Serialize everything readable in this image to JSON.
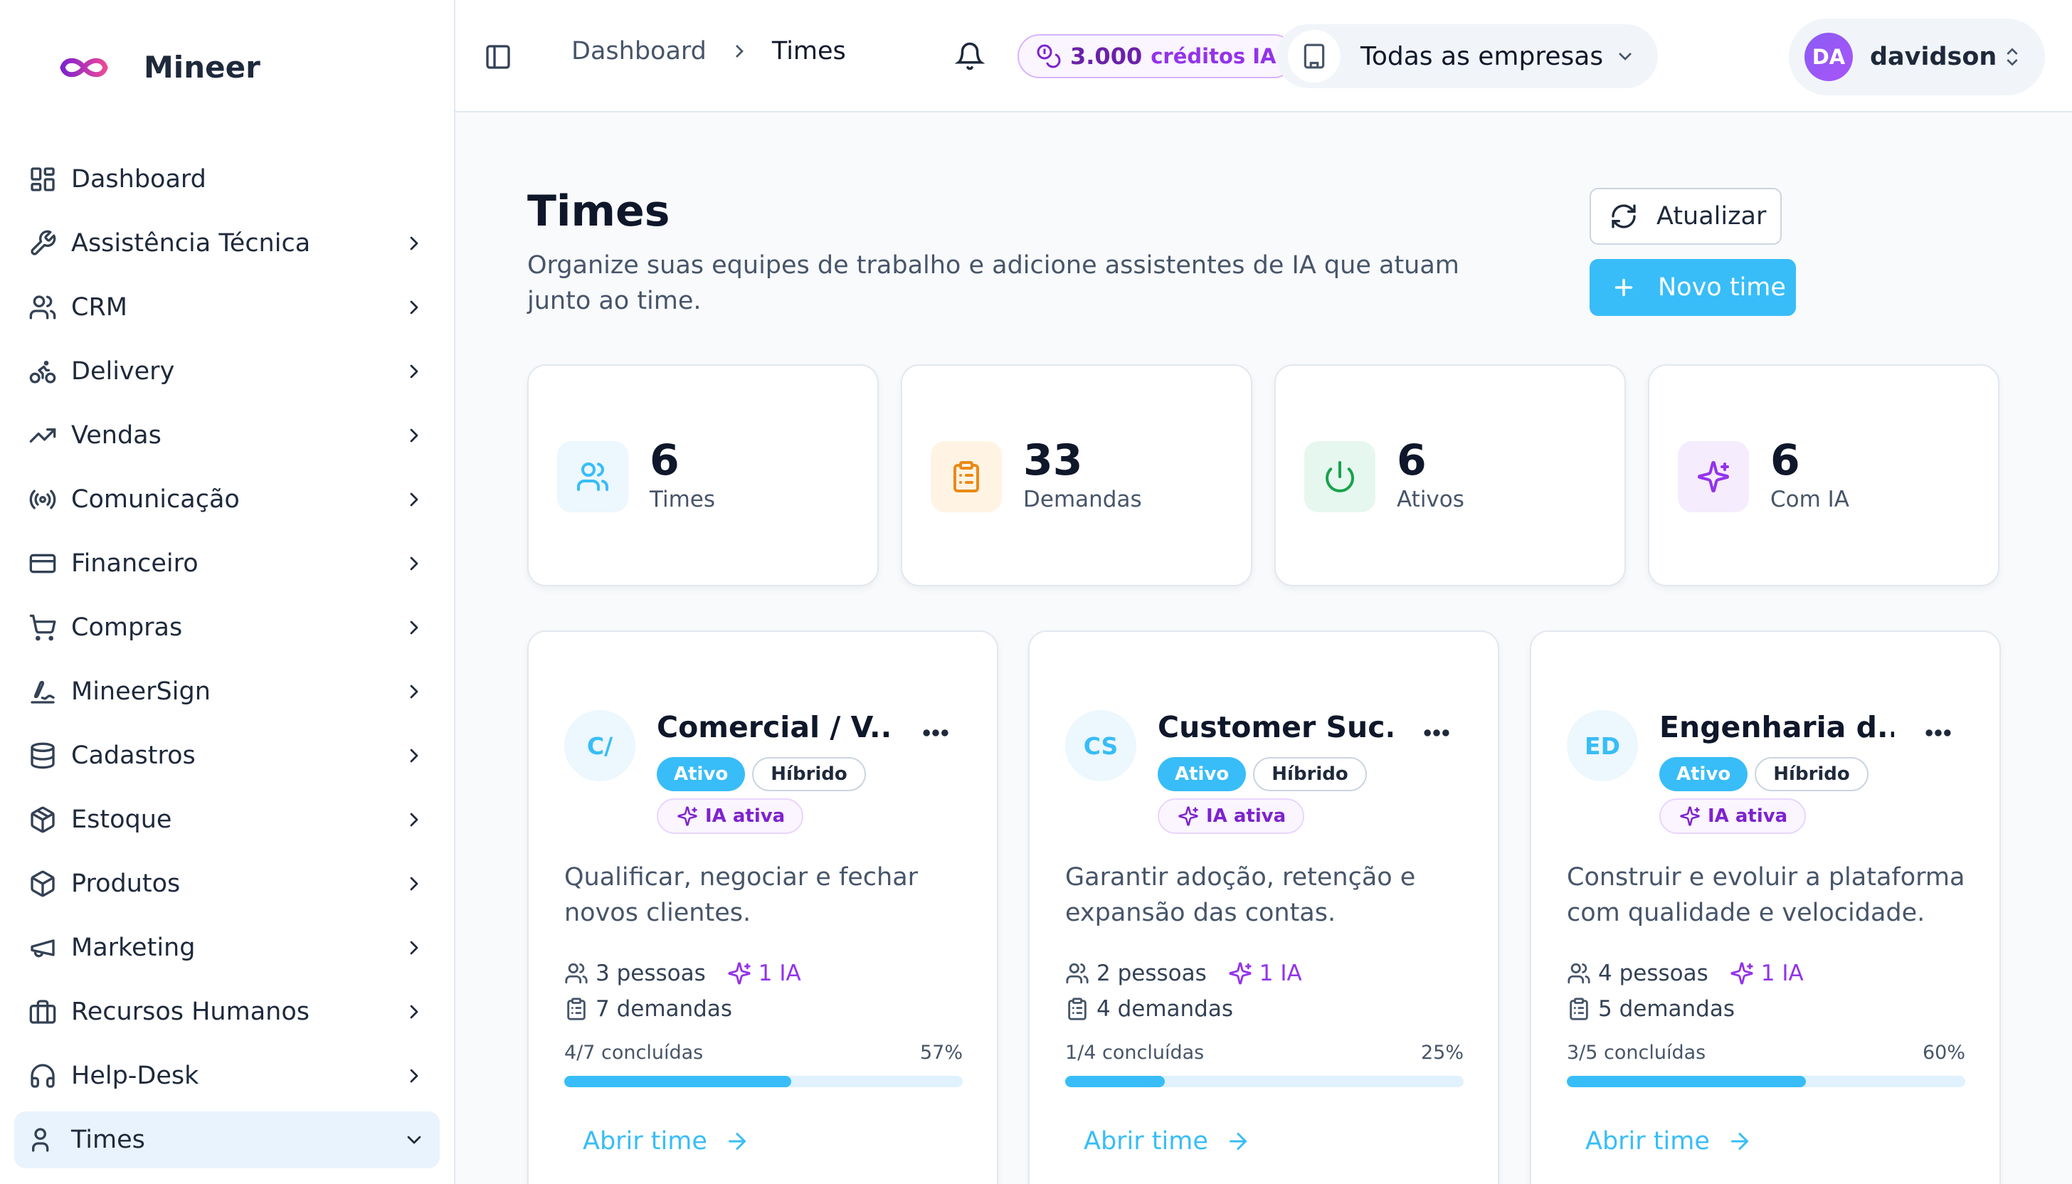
{
  "app": {
    "name": "Mineer"
  },
  "sidebar": {
    "items": [
      {
        "label": "Dashboard",
        "icon": "dashboard-icon",
        "chevron": false
      },
      {
        "label": "Assistência Técnica",
        "icon": "wrench-icon",
        "chevron": true
      },
      {
        "label": "CRM",
        "icon": "users-icon",
        "chevron": true
      },
      {
        "label": "Delivery",
        "icon": "bike-icon",
        "chevron": true
      },
      {
        "label": "Vendas",
        "icon": "trending-up-icon",
        "chevron": true
      },
      {
        "label": "Comunicação",
        "icon": "radio-icon",
        "chevron": true
      },
      {
        "label": "Financeiro",
        "icon": "credit-card-icon",
        "chevron": true
      },
      {
        "label": "Compras",
        "icon": "cart-icon",
        "chevron": true
      },
      {
        "label": "MineerSign",
        "icon": "signature-icon",
        "chevron": true
      },
      {
        "label": "Cadastros",
        "icon": "database-icon",
        "chevron": true
      },
      {
        "label": "Estoque",
        "icon": "package-icon",
        "chevron": true
      },
      {
        "label": "Produtos",
        "icon": "box-icon",
        "chevron": true
      },
      {
        "label": "Marketing",
        "icon": "megaphone-icon",
        "chevron": true
      },
      {
        "label": "Recursos Humanos",
        "icon": "briefcase-icon",
        "chevron": true
      },
      {
        "label": "Help-Desk",
        "icon": "headphones-icon",
        "chevron": true
      },
      {
        "label": "Times",
        "icon": "user-icon",
        "chevron": true,
        "active": true
      }
    ]
  },
  "topbar": {
    "breadcrumb": {
      "parent": "Dashboard",
      "current": "Times"
    },
    "credits": {
      "amount": "3.000",
      "label": "créditos IA"
    },
    "company": {
      "label": "Todas as empresas"
    },
    "user": {
      "initials": "DA",
      "name": "davidson"
    }
  },
  "main": {
    "title": "Times",
    "description": "Organize suas equipes de trabalho e adicione assistentes de IA que atuam junto ao time.",
    "refresh_label": "Atualizar",
    "new_label": "Novo time"
  },
  "stats": [
    {
      "value": "6",
      "label": "Times",
      "icon": "users-icon",
      "bg": "#ecf7fe",
      "color": "#38bdf8"
    },
    {
      "value": "33",
      "label": "Demandas",
      "icon": "clipboard-icon",
      "bg": "#fff3e4",
      "color": "#ea8a16"
    },
    {
      "value": "6",
      "label": "Ativos",
      "icon": "power-icon",
      "bg": "#e6f7ef",
      "color": "#16a34a"
    },
    {
      "value": "6",
      "label": "Com IA",
      "icon": "sparkles-icon",
      "bg": "#f5ecfe",
      "color": "#9333ea"
    }
  ],
  "teams": [
    {
      "initials": "C/",
      "name": "Comercial / V...",
      "status": "Ativo",
      "mode": "Híbrido",
      "ia_label": "IA ativa",
      "description": "Qualificar, negociar e fechar novos clientes.",
      "people": "3 pessoas",
      "ia_count": "1 IA",
      "demands": "7 demandas",
      "progress_label": "4/7 concluídas",
      "progress_pct": "57%",
      "progress": 0.57,
      "open_label": "Abrir time"
    },
    {
      "initials": "CS",
      "name": "Customer Suc...",
      "status": "Ativo",
      "mode": "Híbrido",
      "ia_label": "IA ativa",
      "description": "Garantir adoção, retenção e expansão das contas.",
      "people": "2 pessoas",
      "ia_count": "1 IA",
      "demands": "4 demandas",
      "progress_label": "1/4 concluídas",
      "progress_pct": "25%",
      "progress": 0.25,
      "open_label": "Abrir time"
    },
    {
      "initials": "ED",
      "name": "Engenharia d...",
      "status": "Ativo",
      "mode": "Híbrido",
      "ia_label": "IA ativa",
      "description": "Construir e evoluir a plataforma com qualidade e velocidade.",
      "people": "4 pessoas",
      "ia_count": "1 IA",
      "demands": "5 demandas",
      "progress_label": "3/5 concluídas",
      "progress_pct": "60%",
      "progress": 0.6,
      "open_label": "Abrir time"
    }
  ],
  "colors": {
    "accent": "#38bdf8",
    "ai": "#9333ea",
    "active_nav_bg": "#e8f3fd"
  }
}
